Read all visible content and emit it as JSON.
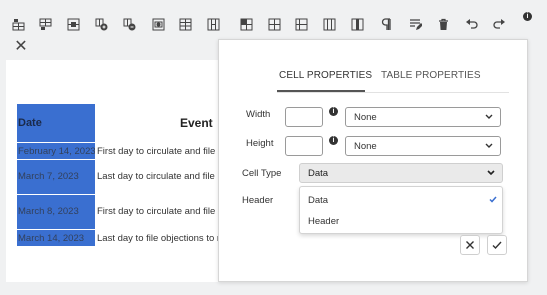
{
  "toolbar": {
    "buttons": [
      {
        "icon": "insert-row-above-icon"
      },
      {
        "icon": "insert-row-below-icon"
      },
      {
        "icon": "insert-column-left-icon"
      },
      {
        "icon": "insert-column-right-icon"
      },
      {
        "icon": "delete-row-icon"
      },
      {
        "icon": "delete-column-icon"
      },
      {
        "icon": "merge-cells-icon"
      },
      {
        "icon": "split-cell-horizontal-icon"
      },
      {
        "icon": "vertical-align-top-icon"
      },
      {
        "icon": "vertical-align-middle-icon"
      },
      {
        "icon": "vertical-align-bottom-icon"
      },
      {
        "icon": "table-split-icon"
      },
      {
        "icon": "paragraph-icon"
      },
      {
        "icon": "table-edit-icon"
      },
      {
        "icon": "trash-icon"
      },
      {
        "icon": "undo-icon"
      },
      {
        "icon": "redo-icon"
      }
    ],
    "info_glyph": "i"
  },
  "close_glyph": "✕",
  "document": {
    "headers": {
      "date": "Date",
      "event": "Event"
    },
    "rows": [
      {
        "date": "February 14, 2023",
        "event": "First day to circulate and file nominating petitions"
      },
      {
        "date": "March 7, 2023",
        "event": "Last day to circulate and file nominating petitions"
      },
      {
        "date": "March 8, 2023",
        "event": "First day to circulate and file nominating petitions"
      },
      {
        "date": "March 14, 2023",
        "event": "Last day to file objections to nominating petitions"
      }
    ]
  },
  "panel": {
    "tabs": [
      {
        "label": "CELL PROPERTIES",
        "active": true
      },
      {
        "label": "TABLE PROPERTIES",
        "active": false
      }
    ],
    "width": {
      "label": "Width",
      "value": "",
      "unit": "None"
    },
    "height": {
      "label": "Height",
      "value": "",
      "unit": "None"
    },
    "cell_type": {
      "label": "Cell Type",
      "value": "Data",
      "options": [
        "Data",
        "Header"
      ],
      "selected": "Data"
    },
    "header": {
      "label": "Header"
    },
    "info_glyph": "i"
  },
  "colors": {
    "accent": "#3a6fd0",
    "check": "#3a6fd0"
  }
}
